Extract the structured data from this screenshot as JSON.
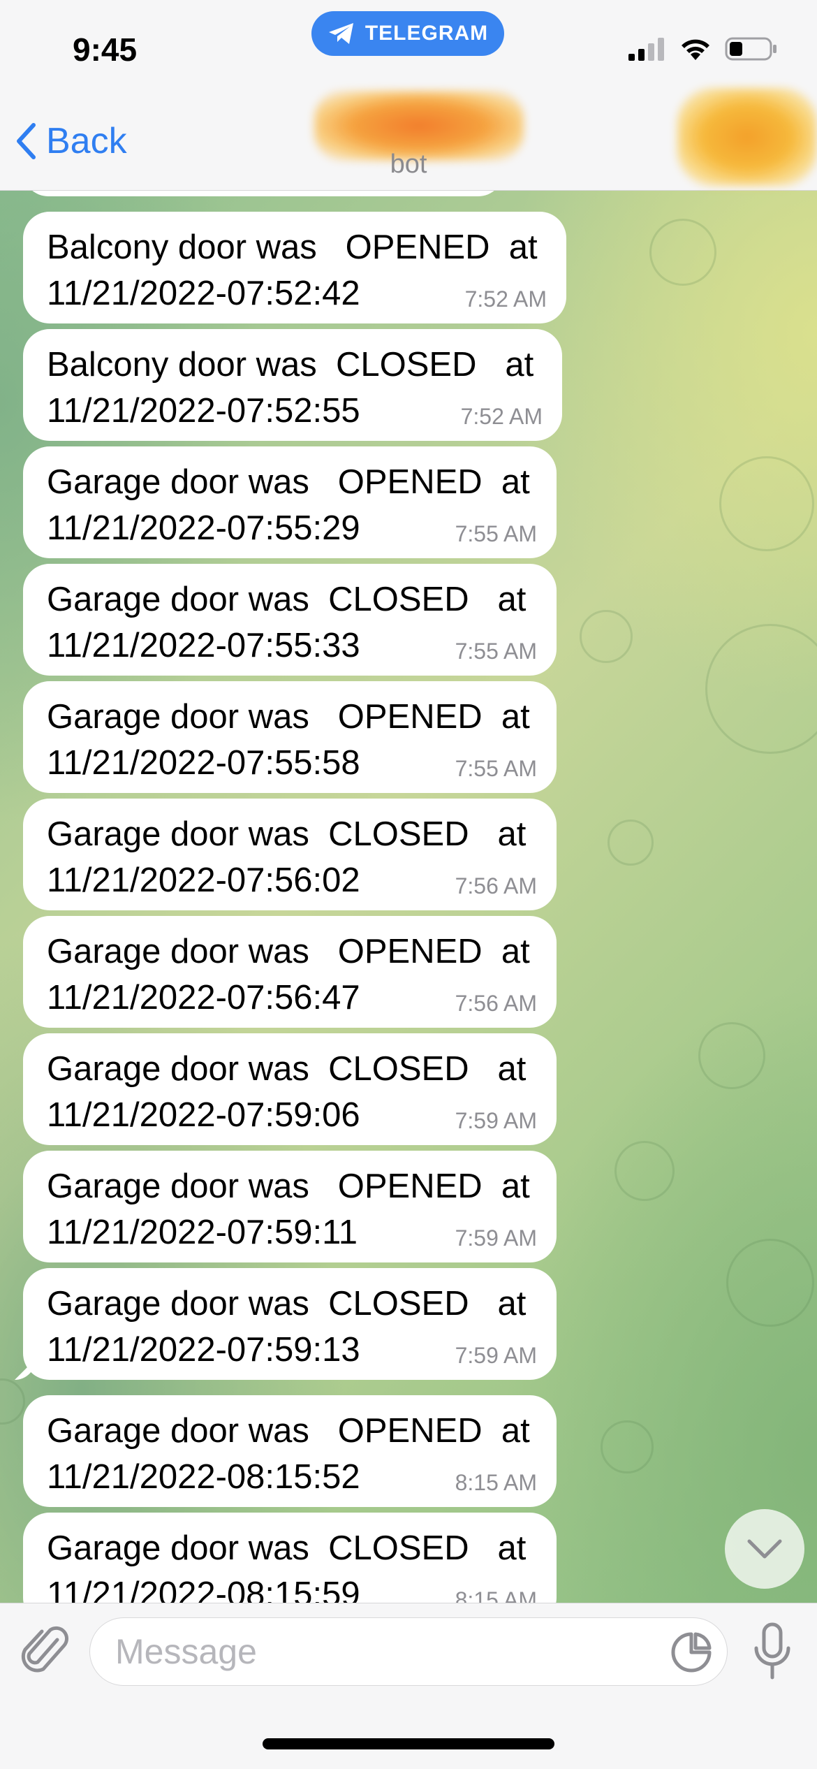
{
  "status_bar": {
    "time": "9:45",
    "pill_label": "TELEGRAM",
    "icons": [
      "cellular-signal-icon",
      "wifi-icon",
      "battery-icon"
    ]
  },
  "nav": {
    "back_label": "Back",
    "subtitle": "bot",
    "accent_color": "#2f7ef1"
  },
  "messages": [
    {
      "line1": "Balcony door was   OPENED  at",
      "line2": "11/21/2022-07:52:42",
      "time": "7:52 AM"
    },
    {
      "line1": "Balcony door was  CLOSED   at",
      "line2": "11/21/2022-07:52:55",
      "time": "7:52 AM"
    },
    {
      "line1": "Garage door was   OPENED  at",
      "line2": "11/21/2022-07:55:29",
      "time": "7:55 AM"
    },
    {
      "line1": "Garage door was  CLOSED   at",
      "line2": "11/21/2022-07:55:33",
      "time": "7:55 AM"
    },
    {
      "line1": "Garage door was   OPENED  at",
      "line2": "11/21/2022-07:55:58",
      "time": "7:55 AM"
    },
    {
      "line1": "Garage door was  CLOSED   at",
      "line2": "11/21/2022-07:56:02",
      "time": "7:56 AM"
    },
    {
      "line1": "Garage door was   OPENED  at",
      "line2": "11/21/2022-07:56:47",
      "time": "7:56 AM"
    },
    {
      "line1": "Garage door was  CLOSED   at",
      "line2": "11/21/2022-07:59:06",
      "time": "7:59 AM"
    },
    {
      "line1": "Garage door was   OPENED  at",
      "line2": "11/21/2022-07:59:11",
      "time": "7:59 AM"
    },
    {
      "line1": "Garage door was  CLOSED   at",
      "line2": "11/21/2022-07:59:13",
      "time": "7:59 AM"
    },
    {
      "line1": "Garage door was   OPENED  at",
      "line2": "11/21/2022-08:15:52",
      "time": "8:15 AM"
    },
    {
      "line1": "Garage door was  CLOSED   at",
      "line2": "11/21/2022-08:15:59",
      "time": "8:15 AM"
    }
  ],
  "composer": {
    "placeholder": "Message"
  }
}
